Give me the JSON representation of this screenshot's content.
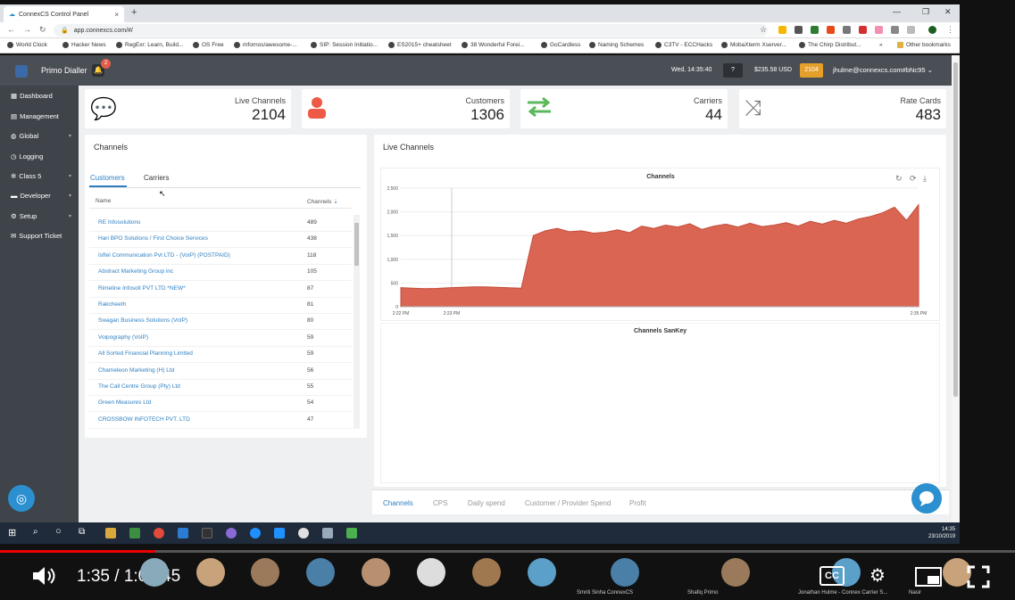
{
  "browser": {
    "tab_title": "ConnexCS Control Panel",
    "url": "app.connexcs.com/#/",
    "new_tab": "+",
    "tab_close": "×",
    "window_controls": [
      "—",
      "❐",
      "✕"
    ],
    "bookmarks": [
      "World Clock",
      "Hacker News",
      "RegExr: Learn, Build...",
      "OS Free",
      "mfornos/awesome-...",
      "SIP: Session Initiatio...",
      "ES2015+ cheatsheet",
      "38 Wonderful Forei...",
      "GoCardless",
      "Naming Schemes",
      "C3TV - ECCHacks",
      "MobaXterm Xserver...",
      "The Chirp Distribut...",
      "»",
      "Other bookmarks"
    ]
  },
  "app": {
    "name": "Primo Dialler",
    "notifications": "2",
    "datetime": "Wed, 14:35:40",
    "help": "?",
    "balance": "$235.58 USD",
    "channels_badge": "2104",
    "user": "jhulme@connexcs.com#bNc95"
  },
  "sidebar": [
    {
      "label": "Dashboard",
      "icon": "dashboard-icon"
    },
    {
      "label": "Management",
      "icon": "management-icon"
    },
    {
      "label": "Global",
      "icon": "globe-icon"
    },
    {
      "label": "Logging",
      "icon": "logging-icon"
    },
    {
      "label": "Class 5",
      "icon": "class5-icon"
    },
    {
      "label": "Developer",
      "icon": "developer-icon"
    },
    {
      "label": "Setup",
      "icon": "setup-icon"
    },
    {
      "label": "Support Ticket",
      "icon": "support-icon"
    }
  ],
  "stats": [
    {
      "title": "Live Channels",
      "value": "2104",
      "icon": "chat-icon",
      "color": "#f0a030"
    },
    {
      "title": "Customers",
      "value": "1306",
      "icon": "person-icon",
      "color": "#ee5a45"
    },
    {
      "title": "Carriers",
      "value": "44",
      "icon": "exchange-icon",
      "color": "#5cb85c"
    },
    {
      "title": "Rate Cards",
      "value": "483",
      "icon": "shuffle-icon",
      "color": "#777777"
    }
  ],
  "channels_panel": {
    "title": "Channels",
    "tabs": [
      "Customers",
      "Carriers"
    ],
    "col_name": "Name",
    "col_channels": "Channels",
    "rows": [
      {
        "name": "RE Infosolutions",
        "channels": "489"
      },
      {
        "name": "Hari BPO Solutions / First Choice Services",
        "channels": "438"
      },
      {
        "name": "Isftel Communication Pvt LTD - (VoIP) (POSTPAID)",
        "channels": "118"
      },
      {
        "name": "Abstract Marketing Group inc",
        "channels": "105"
      },
      {
        "name": "Rimeline Infosoll PVT LTD *NEW*",
        "channels": "87"
      },
      {
        "name": "Rakcheeth",
        "channels": "81"
      },
      {
        "name": "Swagan Business Solutions (VoIP)",
        "channels": "80"
      },
      {
        "name": "Voipography (VoIP)",
        "channels": "59"
      },
      {
        "name": "All Sorted Financial Planning Limited",
        "channels": "59"
      },
      {
        "name": "Chameleon Marketing (H) Ltd",
        "channels": "56"
      },
      {
        "name": "The Call Centre Group (Pty) Ltd",
        "channels": "55"
      },
      {
        "name": "Green Measures Ltd",
        "channels": "54"
      },
      {
        "name": "CROSSBOW INFOTECH PVT. LTD",
        "channels": "47"
      }
    ]
  },
  "live_panel": {
    "title": "Live Channels",
    "sankey_title": "Channels SanKey",
    "bottom_tabs": [
      "Channels",
      "CPS",
      "Daily spend",
      "Customer / Provider Spend",
      "Profit"
    ]
  },
  "chart_data": {
    "type": "area",
    "title": "Channels",
    "xlabel": "",
    "ylabel": "",
    "x_ticks": [
      "2:22 PM",
      "2:23 PM",
      "2:35 PM"
    ],
    "y_ticks": [
      "0",
      "500",
      "1,000",
      "1,500",
      "2,000",
      "2,500"
    ],
    "ylim": [
      0,
      2500
    ],
    "color": "#d96552",
    "series": [
      {
        "values": [
          400,
          390,
          380,
          385,
          400,
          410,
          420,
          420,
          410,
          400,
          390,
          1500,
          1600,
          1650,
          1580,
          1600,
          1550,
          1570,
          1620,
          1560,
          1700,
          1650,
          1720,
          1680,
          1750,
          1630,
          1700,
          1740,
          1680,
          1760,
          1690,
          1720,
          1770,
          1700,
          1800,
          1740,
          1820,
          1760,
          1850,
          1900,
          1980,
          2100,
          1820,
          2150
        ]
      }
    ]
  },
  "taskbar": {
    "time": "14:35",
    "date": "23/10/2019"
  },
  "video": {
    "time": "1:35 / 1:08:45",
    "progress": 0.153,
    "cc": "CC",
    "participants": [
      "Smriti Sinha ConnexCS",
      "Shafiq Primo",
      "Jonathan Hulme - Connex Carrier S...",
      "Nasir"
    ]
  }
}
